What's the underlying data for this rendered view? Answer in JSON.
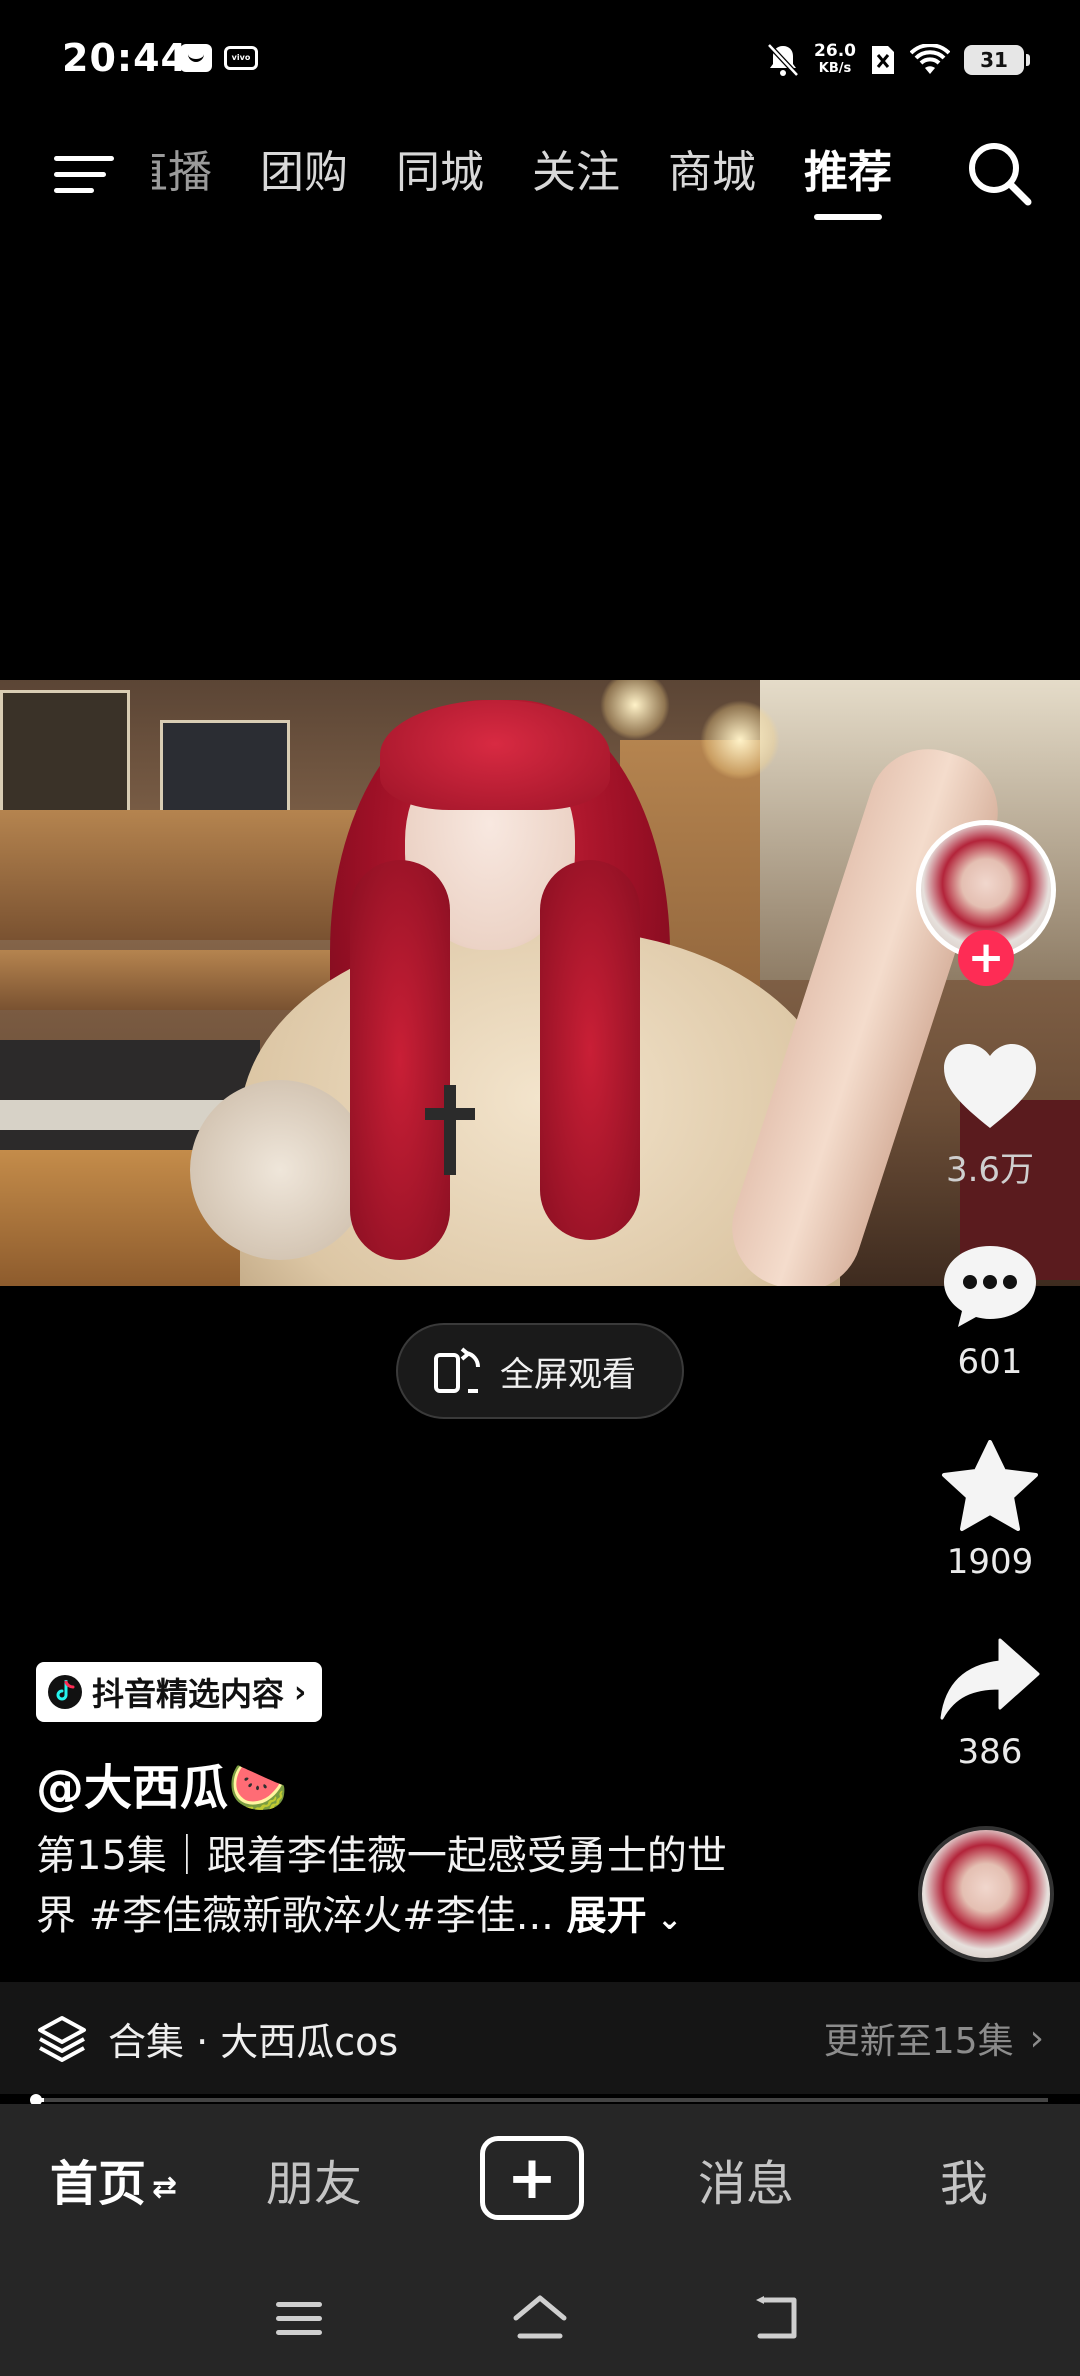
{
  "status_bar": {
    "time": "20:44",
    "net_speed_value": "26.0",
    "net_speed_unit": "KB/s",
    "battery": "31",
    "icons": [
      "message-icon",
      "vivo-icon",
      "mute-icon",
      "sim-off-icon",
      "wifi-icon",
      "battery-icon"
    ]
  },
  "top_nav": {
    "tabs": [
      {
        "label": "直播",
        "state": "faded"
      },
      {
        "label": "团购",
        "state": "normal"
      },
      {
        "label": "同城",
        "state": "normal"
      },
      {
        "label": "关注",
        "state": "normal"
      },
      {
        "label": "商城",
        "state": "normal"
      },
      {
        "label": "推荐",
        "state": "active"
      }
    ]
  },
  "player": {
    "fullscreen_label": "全屏观看"
  },
  "actions": {
    "likes": "3.6万",
    "comments": "601",
    "favorites": "1909",
    "shares": "386"
  },
  "info": {
    "badge_label": "抖音精选内容",
    "author": "@大西瓜🍉",
    "desc_line1": "第15集｜跟着李佳薇一起感受勇士的世",
    "desc_line2": "界 #李佳薇新歌淬火#李佳...",
    "expand_label": "展开"
  },
  "collection": {
    "label": "合集 · 大西瓜cos",
    "update": "更新至15集"
  },
  "progress": {
    "fraction": 0.01
  },
  "bottom_nav": {
    "home": "首页",
    "friends": "朋友",
    "messages": "消息",
    "me": "我"
  },
  "colors": {
    "accent": "#fe2c55",
    "background": "#000000",
    "bottom_bar": "#262626"
  }
}
